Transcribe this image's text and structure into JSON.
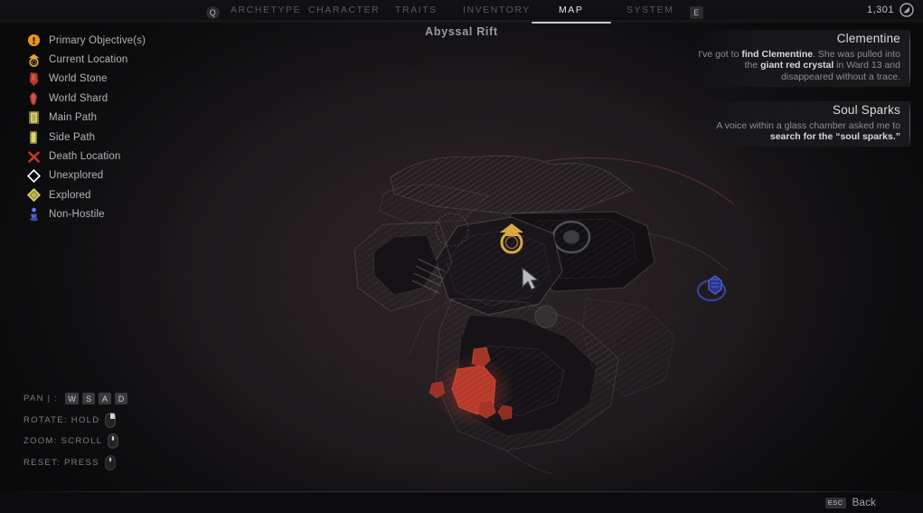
{
  "topbar": {
    "menu_key": "Q",
    "tabs": [
      {
        "label": "ARCHETYPE",
        "active": false
      },
      {
        "label": "CHARACTER",
        "active": false
      },
      {
        "label": "TRAITS",
        "active": false
      },
      {
        "label": "INVENTORY",
        "active": false
      },
      {
        "label": "MAP",
        "active": true
      },
      {
        "label": "SYSTEM",
        "active": false
      }
    ],
    "next_key": "E",
    "currency": {
      "value": "1,301",
      "icon": "scrap-icon"
    }
  },
  "map": {
    "title": "Abyssal Rift",
    "cursor_icon": "pointer-cursor"
  },
  "legend": {
    "items": [
      {
        "label": "Primary Objective(s)",
        "icon": "objective-exclamation-icon",
        "color": "#e8931f"
      },
      {
        "label": "Current Location",
        "icon": "current-location-icon",
        "color": "#d8a843"
      },
      {
        "label": "World Stone",
        "icon": "world-stone-icon",
        "color": "#b63a2e"
      },
      {
        "label": "World Shard",
        "icon": "world-shard-icon",
        "color": "#b63a2e"
      },
      {
        "label": "Main Path",
        "icon": "main-path-door-icon",
        "color": "#d8cf72"
      },
      {
        "label": "Side Path",
        "icon": "side-path-door-icon",
        "color": "#d8cf72"
      },
      {
        "label": "Death Location",
        "icon": "death-cross-icon",
        "color": "#c0392b"
      },
      {
        "label": "Unexplored",
        "icon": "unexplored-diamond-icon",
        "color": "#ffffff"
      },
      {
        "label": "Explored",
        "icon": "explored-diamond-icon",
        "color": "#e3d95c"
      },
      {
        "label": "Non-Hostile",
        "icon": "non-hostile-npc-icon",
        "color": "#4a5fc1"
      }
    ]
  },
  "quests": [
    {
      "title": "Clementine",
      "parts": [
        {
          "text": "I've got to ",
          "bold": false
        },
        {
          "text": "find Clementine",
          "bold": true
        },
        {
          "text": ". She was pulled into the ",
          "bold": false
        },
        {
          "text": "giant red crystal",
          "bold": true
        },
        {
          "text": " in Ward 13 and disappeared without a trace.",
          "bold": false
        }
      ]
    },
    {
      "title": "Soul Sparks",
      "parts": [
        {
          "text": "A voice within a glass chamber asked me to ",
          "bold": false
        },
        {
          "text": "search for the “soul sparks.”",
          "bold": true
        }
      ]
    }
  ],
  "hints": [
    {
      "label": "PAN | :",
      "keys": [
        "W",
        "S",
        "A",
        "D"
      ],
      "icon": null
    },
    {
      "label": "ROTATE: HOLD",
      "keys": [],
      "icon": "mouse-right-click-icon"
    },
    {
      "label": "ZOOM: SCROLL",
      "keys": [],
      "icon": "mouse-scroll-wheel-icon"
    },
    {
      "label": "RESET: PRESS",
      "keys": [],
      "icon": "mouse-middle-click-icon"
    }
  ],
  "bottombar": {
    "back_key": "ESC",
    "back_label": "Back"
  }
}
